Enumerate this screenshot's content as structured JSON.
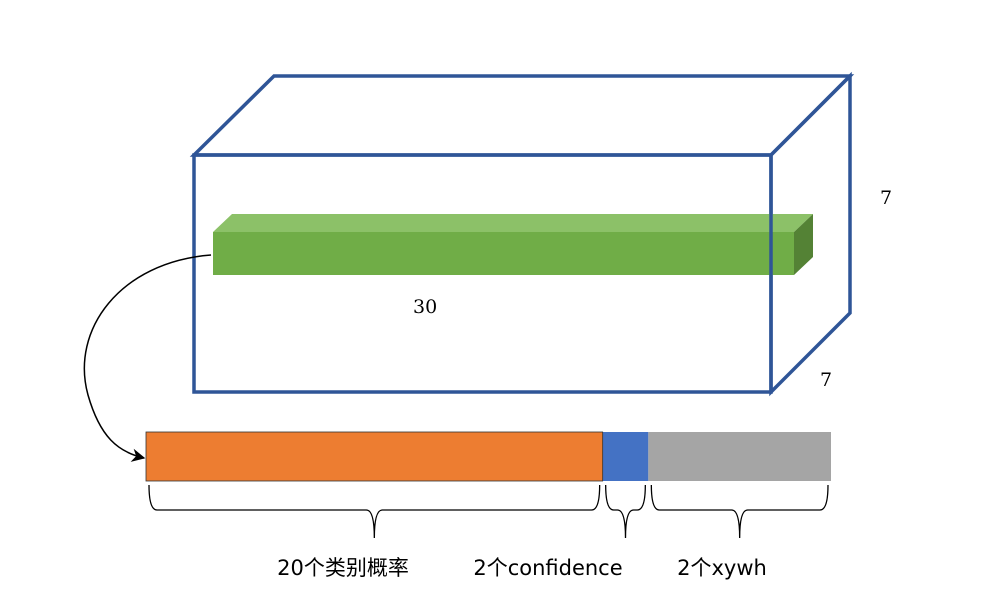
{
  "dimensions": {
    "height_label": "7",
    "depth_label": "7",
    "vector_length_label": "30"
  },
  "segments": [
    {
      "label": "20个类别概率",
      "count": 20,
      "color": "#ED7D31"
    },
    {
      "label": "2个confidence",
      "count": 2,
      "color": "#4472C4"
    },
    {
      "label": "2个xywh",
      "count": 8,
      "color": "#A5A5A5"
    }
  ],
  "colors": {
    "box_edge": "#2F5597",
    "vector_front": "#70AD47",
    "vector_top": "#8CC168",
    "vector_side": "#548235"
  }
}
